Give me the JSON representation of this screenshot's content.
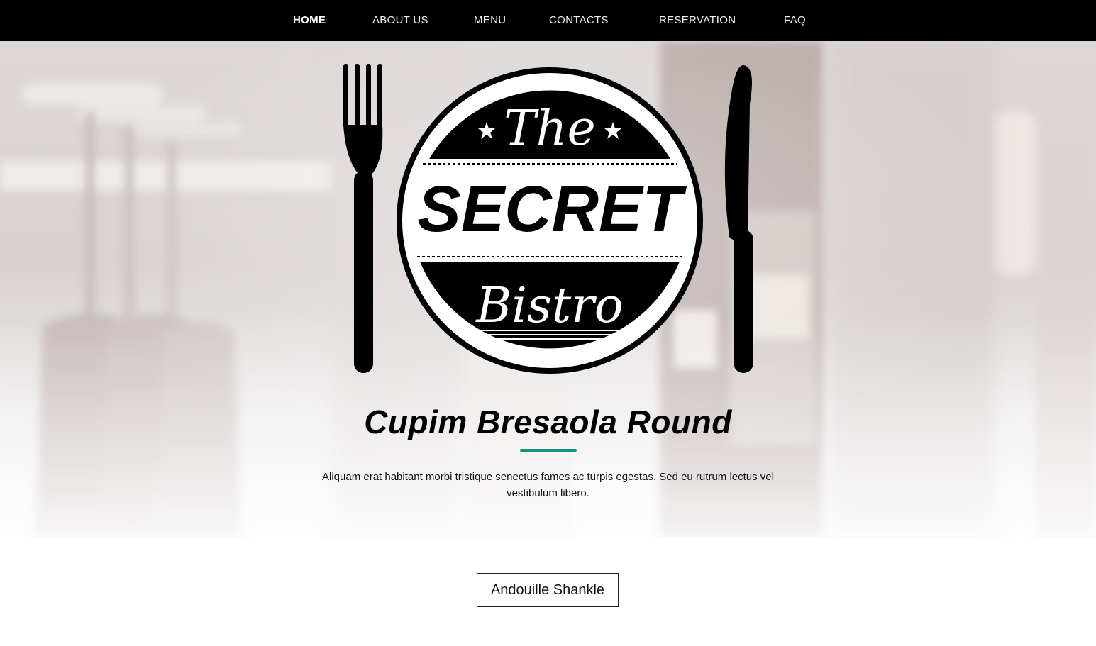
{
  "nav": {
    "items": [
      {
        "label": "HOME",
        "active": true
      },
      {
        "label": "ABOUT US"
      },
      {
        "label": "MENU"
      },
      {
        "label": "CONTACTS"
      },
      {
        "label": "RESERVATION"
      },
      {
        "label": "FAQ"
      }
    ]
  },
  "logo": {
    "the": "The",
    "secret": "SECRET",
    "bistro": "Bistro"
  },
  "hero": {
    "title": "Cupim Bresaola Round",
    "text_line1": "Aliquam erat habitant morbi tristique senectus fames ac turpis egestas. Sed eu rutrum lectus vel",
    "text_line2": "vestibulum libero."
  },
  "cta": {
    "label": "Andouille Shankle"
  },
  "colors": {
    "accent": "#17947f",
    "nav_bg": "#000000"
  },
  "icons": [
    "fork-icon",
    "knife-icon",
    "star-icon"
  ]
}
